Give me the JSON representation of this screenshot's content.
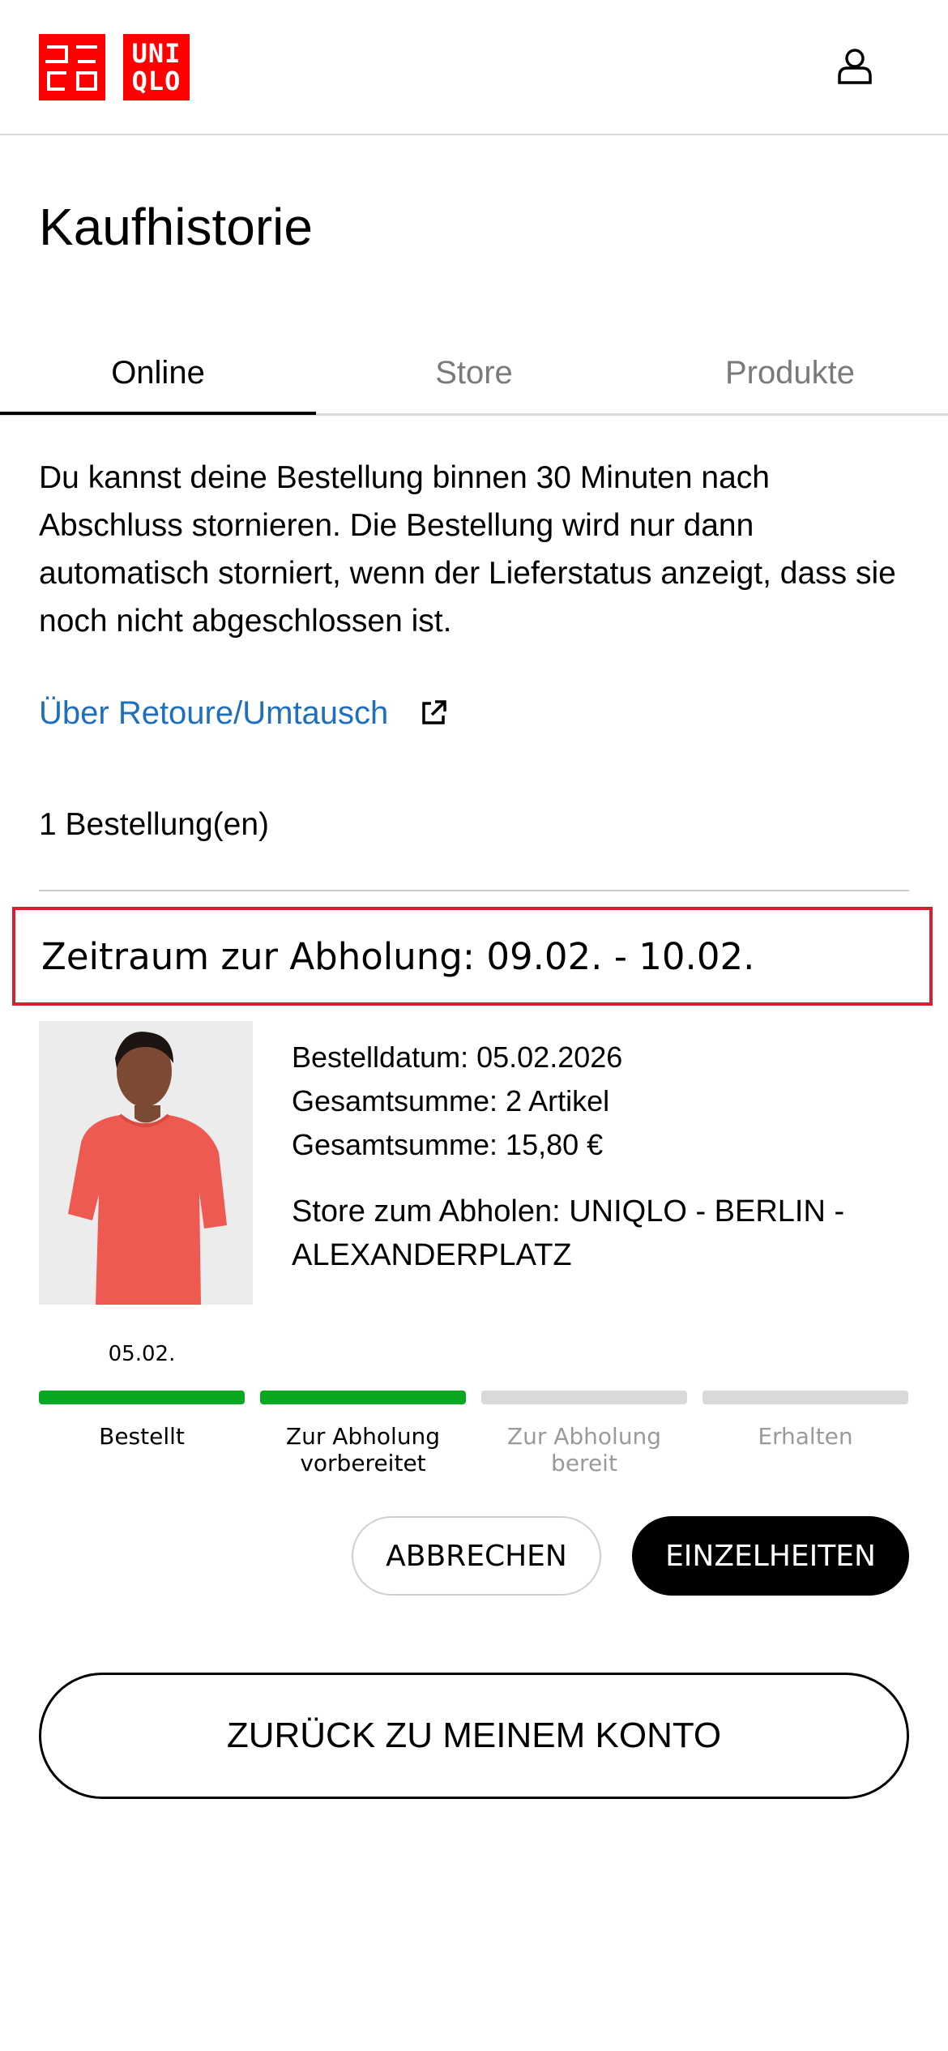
{
  "header": {
    "logo_text_line1": "UNI",
    "logo_text_line2": "QLO",
    "brand_color": "#ff0000",
    "account_icon": "user-icon"
  },
  "page_title": "Kaufhistorie",
  "tabs": [
    {
      "label": "Online",
      "active": true
    },
    {
      "label": "Store",
      "active": false
    },
    {
      "label": "Produkte",
      "active": false
    }
  ],
  "info_text": "Du kannst deine Bestellung binnen 30 Minuten nach Abschluss stornieren. Die Bestellung wird nur dann automatisch storniert, wenn der Lieferstatus anzeigt, dass sie noch nicht abgeschlossen ist.",
  "return_link": {
    "label": "Über Retoure/Umtausch",
    "icon": "external-link-icon",
    "color": "#1f6fbf"
  },
  "order_count": "1 Bestellung(en)",
  "order": {
    "pickup_period": "Zeitraum zur Abholung: 09.02. - 10.02.",
    "order_date": "Bestelldatum: 05.02.2026",
    "total_items": "Gesamtsumme: 2 Artikel",
    "total_price": "Gesamtsumme: 15,80 €",
    "pickup_store": "Store zum Abholen: UNIQLO - BERLIN - ALEXANDERPLATZ",
    "progress": {
      "date": "05.02.",
      "done_color": "#0aa820",
      "steps": [
        {
          "label": "Bestellt",
          "done": true
        },
        {
          "label": "Zur Abholung vorbereitet",
          "done": true
        },
        {
          "label": "Zur Abholung bereit",
          "done": false
        },
        {
          "label": "Erhalten",
          "done": false
        }
      ]
    },
    "cancel_label": "ABBRECHEN",
    "details_label": "EINZELHEITEN"
  },
  "back_button_label": "ZURÜCK ZU MEINEM KONTO",
  "highlight_color": "#d6202e"
}
